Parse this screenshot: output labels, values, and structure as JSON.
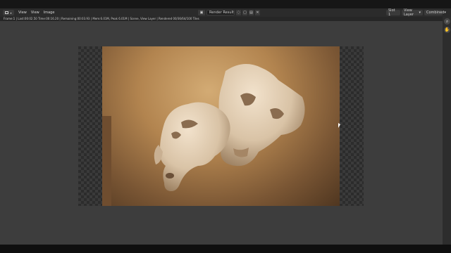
{
  "header": {
    "menus": [
      "View",
      "View",
      "Image"
    ],
    "image_name": "Render Result",
    "slot": "Slot 1",
    "view_layer": "View Layer",
    "pass": "Combined"
  },
  "status": {
    "text": "Frame:1 | Last:00:02.50 Time:00:16.20 | Remaining:00:03.93 | Mem:6.01M, Peak 6.01M | Scene, View Layer | Rendered 00/36/64/100 Tiles"
  },
  "icons": {
    "editor_type": "image-editor-icon",
    "browse": "image-browse-icon",
    "zoom": "zoom-icon",
    "pan": "hand-pan-icon"
  }
}
